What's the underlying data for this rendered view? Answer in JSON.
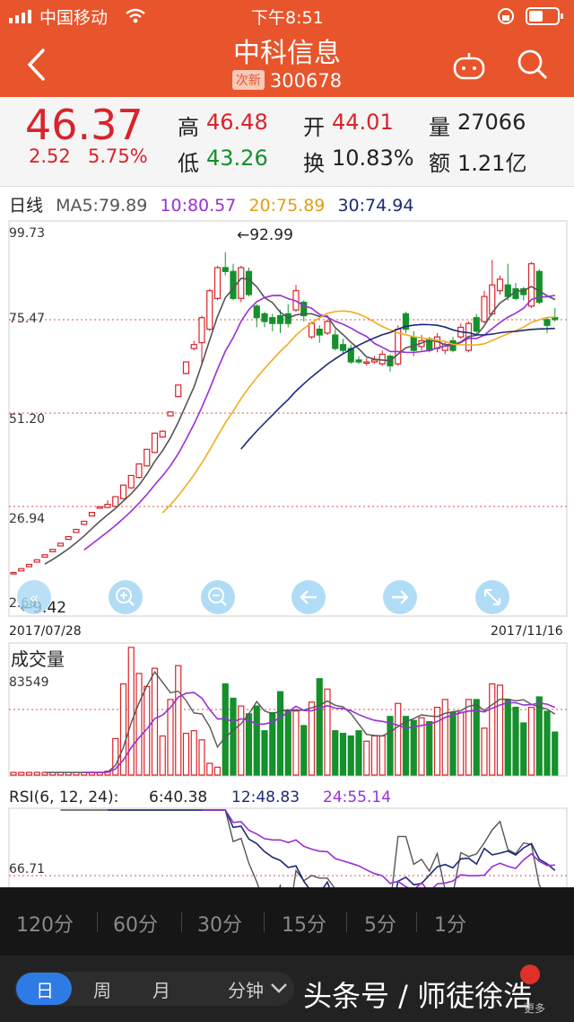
{
  "status": {
    "carrier": "中国移动",
    "time": "下午8:51"
  },
  "header": {
    "stock_name": "中科信息",
    "badge": "次新",
    "code": "300678"
  },
  "quote": {
    "price": "46.37",
    "change": "2.52",
    "change_pct": "5.75%",
    "high_label": "高",
    "high": "46.48",
    "low_label": "低",
    "low": "43.26",
    "open_label": "开",
    "open": "44.01",
    "turnover_label": "换",
    "turnover": "10.83%",
    "volume_label": "量",
    "volume": "27066",
    "amount_label": "额",
    "amount": "1.21亿"
  },
  "ma_line": {
    "period": "日线",
    "ma5": "MA5:79.89",
    "ma10": "10:80.57",
    "ma20": "20:75.89",
    "ma30": "30:74.94"
  },
  "colors": {
    "up": "#d8232a",
    "down": "#15902c",
    "ma5": "#555555",
    "ma10": "#9a2fd6",
    "ma20": "#f0ad1c",
    "ma30": "#1c2a78"
  },
  "kline": {
    "y_labels": [
      "99.73",
      "75.47",
      "51.20",
      "26.94",
      "2.68"
    ],
    "max_label": "←92.99",
    "min_label": "←9.42",
    "start_date": "2017/07/28",
    "end_date": "2017/11/16",
    "controls": [
      "zoom-out-icon",
      "zoom-in-icon",
      "zoom-reduce-icon",
      "arrow-left-icon",
      "arrow-right-icon",
      "fullscreen-icon"
    ]
  },
  "volume": {
    "title": "成交量",
    "label": "83549"
  },
  "rsi": {
    "title": "RSI(6, 12, 24):",
    "rsi6": "6:40.38",
    "rsi12": "12:48.83",
    "rsi24": "24:55.14",
    "label": "66.71"
  },
  "timeframes": [
    "120分",
    "60分",
    "30分",
    "15分",
    "5分",
    "1分"
  ],
  "bottom_tabs": {
    "day": "日",
    "week": "周",
    "month": "月",
    "minute": "分钟",
    "more": "更多"
  },
  "watermark": "头条号 / 师徒徐浩",
  "chart_data": {
    "type": "candlestick",
    "dates": [
      "2017/07/28",
      "2017/11/16"
    ],
    "y_ticks": [
      99.73,
      75.47,
      51.2,
      26.94,
      2.68
    ],
    "ylim": [
      2.68,
      99.73
    ],
    "high_point": 92.99,
    "low_point": 9.42,
    "candles": [
      [
        9.42,
        9.8,
        9.3,
        9.9,
        "up"
      ],
      [
        10.2,
        10.8,
        10.1,
        10.9,
        "up"
      ],
      [
        11.3,
        11.9,
        11.2,
        12.0,
        "up"
      ],
      [
        12.5,
        13.1,
        12.4,
        13.2,
        "up"
      ],
      [
        13.8,
        14.4,
        13.7,
        14.5,
        "up"
      ],
      [
        15.2,
        15.8,
        15.1,
        15.9,
        "up"
      ],
      [
        16.7,
        17.4,
        16.6,
        17.5,
        "up"
      ],
      [
        18.4,
        19.1,
        18.3,
        19.2,
        "up"
      ],
      [
        20.2,
        21.0,
        20.1,
        21.1,
        "up"
      ],
      [
        22.3,
        23.1,
        22.2,
        23.2,
        "up"
      ],
      [
        24.5,
        25.4,
        24.4,
        25.5,
        "up"
      ],
      [
        26.5,
        26.9,
        26.4,
        27.0,
        "up"
      ],
      [
        26.7,
        27.5,
        26.5,
        28.6,
        "up"
      ],
      [
        27.0,
        29.5,
        26.8,
        29.6,
        "up"
      ],
      [
        29.0,
        32.5,
        28.8,
        32.6,
        "up"
      ],
      [
        31.8,
        35.0,
        31.5,
        35.1,
        "up"
      ],
      [
        34.5,
        38.0,
        34.2,
        38.1,
        "up"
      ],
      [
        37.5,
        41.8,
        37.3,
        41.9,
        "up"
      ],
      [
        41.0,
        46.0,
        40.8,
        46.1,
        "up"
      ],
      [
        45.0,
        46.5,
        44.8,
        46.7,
        "up"
      ],
      [
        50.5,
        51.5,
        50.3,
        51.6,
        "up"
      ],
      [
        55.5,
        58.5,
        55.3,
        58.6,
        "up"
      ],
      [
        61.5,
        64.5,
        61.3,
        64.6,
        "up"
      ],
      [
        68.0,
        69.0,
        67.5,
        70.0,
        "up"
      ],
      [
        69.5,
        76.0,
        64.0,
        76.5,
        "up"
      ],
      [
        73.0,
        83.0,
        72.5,
        83.5,
        "up"
      ],
      [
        81.0,
        89.0,
        80.5,
        89.5,
        "up"
      ],
      [
        88.0,
        89.0,
        87.0,
        92.99,
        "down"
      ],
      [
        88.0,
        81.0,
        80.5,
        90.0,
        "down"
      ],
      [
        81.0,
        89.0,
        80.0,
        89.5,
        "up"
      ],
      [
        88.0,
        82.0,
        81.5,
        89.0,
        "down"
      ],
      [
        76.0,
        79.0,
        73.5,
        79.5,
        "down"
      ],
      [
        77.0,
        75.0,
        73.5,
        77.5,
        "down"
      ],
      [
        76.0,
        74.5,
        72.5,
        77.0,
        "down"
      ],
      [
        74.5,
        76.5,
        72.0,
        78.0,
        "down"
      ],
      [
        77.0,
        74.5,
        73.5,
        79.5,
        "down"
      ],
      [
        78.0,
        83.0,
        77.5,
        84.5,
        "up"
      ],
      [
        80.0,
        76.5,
        75.0,
        80.5,
        "down"
      ],
      [
        71.0,
        74.5,
        70.5,
        75.0,
        "up"
      ],
      [
        71.5,
        73.0,
        69.5,
        74.0,
        "down"
      ],
      [
        72.0,
        75.0,
        71.5,
        75.5,
        "up"
      ],
      [
        71.5,
        68.0,
        67.5,
        73.0,
        "down"
      ],
      [
        69.0,
        67.5,
        66.5,
        70.5,
        "down"
      ],
      [
        68.0,
        64.5,
        64.0,
        69.0,
        "down"
      ],
      [
        65.0,
        64.5,
        64.0,
        66.0,
        "down"
      ],
      [
        64.5,
        64.5,
        63.5,
        65.5,
        "up"
      ],
      [
        64.5,
        65.0,
        64.0,
        66.0,
        "up"
      ],
      [
        64.0,
        66.5,
        63.5,
        67.5,
        "up"
      ],
      [
        66.0,
        63.5,
        62.0,
        66.5,
        "down"
      ],
      [
        64.0,
        73.0,
        63.5,
        74.0,
        "up"
      ],
      [
        77.0,
        73.0,
        72.0,
        77.5,
        "down"
      ],
      [
        71.0,
        67.5,
        66.0,
        72.5,
        "down"
      ],
      [
        68.5,
        70.0,
        67.5,
        71.5,
        "up"
      ],
      [
        70.5,
        67.5,
        67.0,
        71.0,
        "down"
      ],
      [
        68.0,
        71.0,
        67.0,
        72.0,
        "up"
      ],
      [
        67.5,
        69.0,
        66.5,
        70.0,
        "up"
      ],
      [
        70.0,
        67.5,
        67.0,
        71.0,
        "down"
      ],
      [
        71.0,
        73.5,
        70.5,
        74.5,
        "up"
      ],
      [
        67.5,
        74.5,
        67.0,
        75.0,
        "up"
      ],
      [
        76.0,
        72.5,
        71.5,
        77.0,
        "down"
      ],
      [
        75.0,
        81.5,
        74.5,
        83.0,
        "up"
      ],
      [
        77.0,
        84.5,
        76.5,
        91.0,
        "up"
      ],
      [
        83.0,
        86.0,
        82.0,
        87.0,
        "up"
      ],
      [
        84.5,
        81.5,
        80.5,
        90.0,
        "down"
      ],
      [
        83.5,
        81.0,
        80.5,
        85.0,
        "down"
      ],
      [
        83.5,
        82.0,
        80.5,
        84.0,
        "down"
      ],
      [
        79.0,
        90.0,
        78.5,
        90.5,
        "up"
      ],
      [
        88.0,
        80.0,
        79.5,
        88.5,
        "down"
      ],
      [
        74.0,
        75.5,
        72.0,
        76.0,
        "down"
      ],
      [
        75.5,
        76.0,
        75.0,
        78.5,
        "down"
      ]
    ],
    "volume_levels": [
      0.02,
      0.02,
      0.02,
      0.02,
      0.02,
      0.02,
      0.02,
      0.02,
      0.02,
      0.02,
      0.02,
      0.02,
      0.03,
      0.28,
      0.7,
      0.98,
      0.78,
      0.68,
      0.82,
      0.3,
      0.58,
      0.84,
      0.32,
      0.34,
      0.27,
      0.09,
      0.06,
      0.7,
      0.59,
      0.53,
      0.47,
      0.53,
      0.34,
      0.48,
      0.64,
      0.5,
      0.5,
      0.38,
      0.56,
      0.74,
      0.66,
      0.34,
      0.32,
      0.3,
      0.34,
      0.26,
      0.3,
      0.3,
      0.45,
      0.55,
      0.45,
      0.42,
      0.44,
      0.41,
      0.52,
      0.58,
      0.48,
      0.48,
      0.58,
      0.58,
      0.36,
      0.7,
      0.69,
      0.58,
      0.52,
      0.4,
      0.52,
      0.6,
      0.49,
      0.33
    ]
  }
}
